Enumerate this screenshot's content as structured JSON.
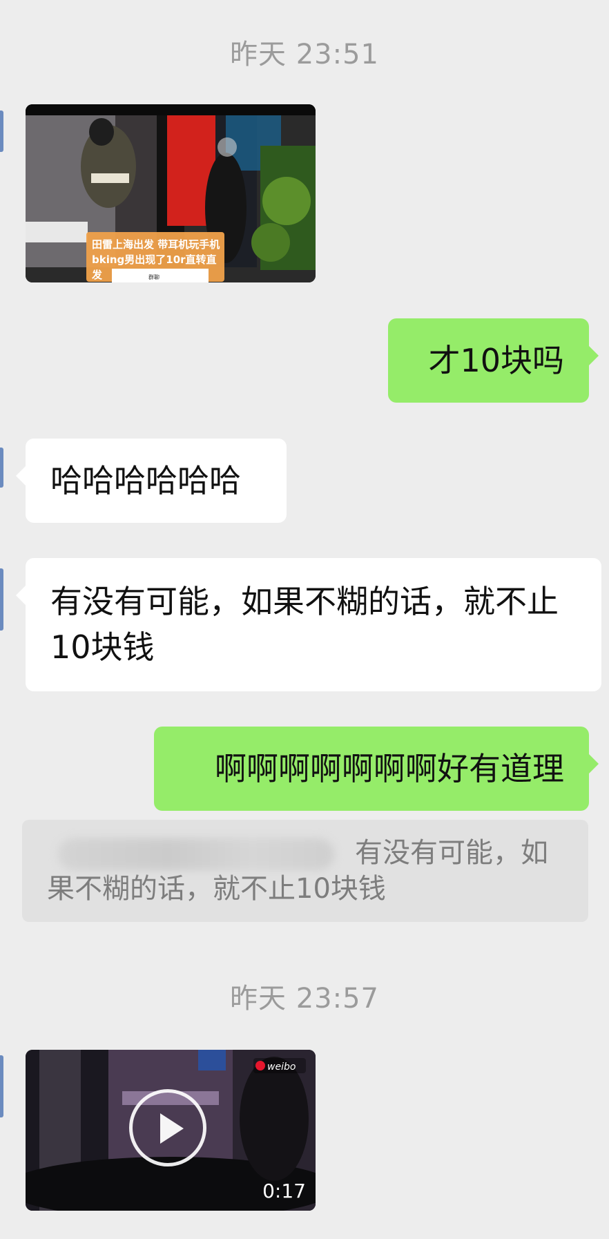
{
  "timestamps": [
    "昨天 23:51",
    "昨天 23:57"
  ],
  "messages": {
    "image1_caption_line1": "田雷上海出发 带耳机玩手机",
    "image1_caption_line2": "bking男出现了10r直转直",
    "image1_caption_line3": "发",
    "image1_subbar": "群聊",
    "msg_out_1": "才10块吗",
    "msg_in_1": "哈哈哈哈哈哈",
    "msg_in_2": "有没有可能，如果不糊的话，就不止10块钱",
    "msg_out_2": "啊啊啊啊啊啊啊好有道理",
    "quote_text": "有没有可能，如果不糊的话，就不止10块钱",
    "video_duration": "0:17",
    "video_watermark": "weibo"
  },
  "colors": {
    "background": "#ededed",
    "bubble_out": "#95ec69",
    "bubble_in": "#ffffff",
    "timestamp": "#9b9b9b",
    "quote_bg": "#e1e1e1"
  },
  "icons": [
    "play-icon"
  ]
}
